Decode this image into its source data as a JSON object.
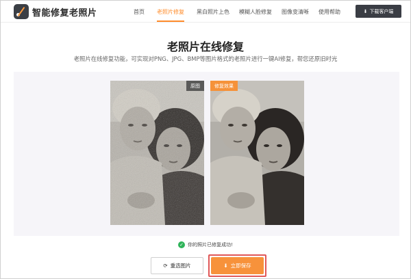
{
  "brand": {
    "name": "智能修复老照片"
  },
  "nav": {
    "items": [
      {
        "label": "首页",
        "active": false
      },
      {
        "label": "老照片修复",
        "active": true
      },
      {
        "label": "黑白照片上色",
        "active": false
      },
      {
        "label": "模糊人脸修复",
        "active": false
      },
      {
        "label": "图像变清晰",
        "active": false
      },
      {
        "label": "使用帮助",
        "active": false
      }
    ],
    "download_label": "下载客户端"
  },
  "main": {
    "title": "老照片在线修复",
    "subtitle": "老照片在线修复功能，可实现对PNG、JPG、BMP等图片格式的老照片进行一键AI修复，帮您还原旧时光"
  },
  "compare": {
    "original_tag": "原图",
    "repaired_tag": "修复效果"
  },
  "status": {
    "text": "你的照片已修复成功!"
  },
  "actions": {
    "reselect_label": "重选图片",
    "save_label": "立即保存"
  },
  "colors": {
    "accent": "#ff8c2b",
    "dark": "#3a3d44",
    "success": "#2fb45a"
  }
}
